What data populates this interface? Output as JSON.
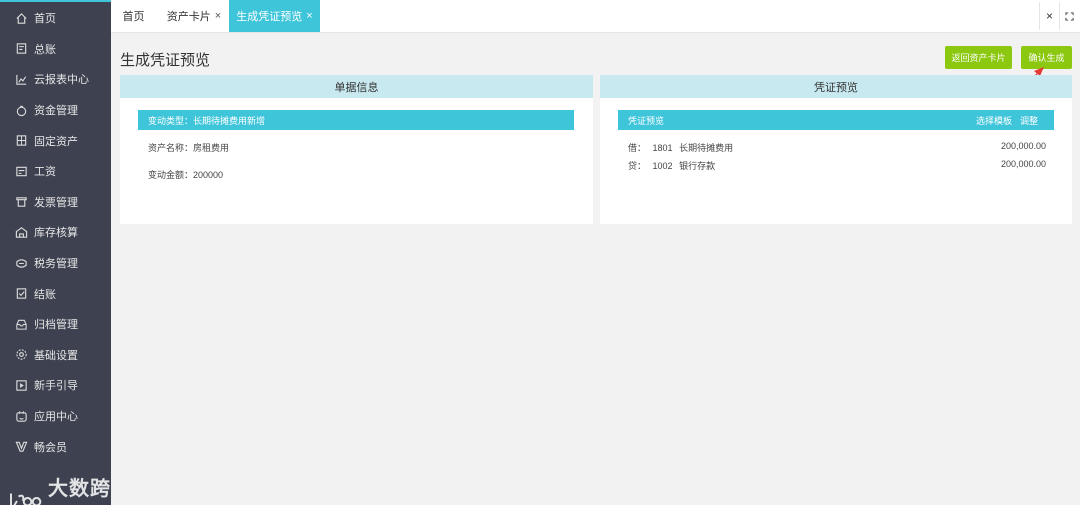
{
  "sidebar": {
    "items": [
      {
        "label": "首页",
        "icon": "home-icon"
      },
      {
        "label": "总账",
        "icon": "ledger-icon"
      },
      {
        "label": "云报表中心",
        "icon": "chart-icon"
      },
      {
        "label": "资金管理",
        "icon": "money-bag-icon"
      },
      {
        "label": "固定资产",
        "icon": "asset-icon"
      },
      {
        "label": "工资",
        "icon": "salary-icon"
      },
      {
        "label": "发票管理",
        "icon": "invoice-icon"
      },
      {
        "label": "库存核算",
        "icon": "warehouse-icon"
      },
      {
        "label": "税务管理",
        "icon": "tax-icon"
      },
      {
        "label": "结账",
        "icon": "closing-icon"
      },
      {
        "label": "归档管理",
        "icon": "archive-icon"
      },
      {
        "label": "基础设置",
        "icon": "gear-icon"
      },
      {
        "label": "新手引导",
        "icon": "play-guide-icon"
      },
      {
        "label": "应用中心",
        "icon": "app-center-icon"
      },
      {
        "label": "畅会员",
        "icon": "vip-icon"
      }
    ]
  },
  "watermark": {
    "text": "大数跨境"
  },
  "tabs": [
    {
      "label": "首页",
      "closable": false
    },
    {
      "label": "资产卡片",
      "closable": true
    },
    {
      "label": "生成凭证预览",
      "closable": true,
      "active": true
    }
  ],
  "tab_close_glyph": "×",
  "page_title": "生成凭证预览",
  "buttons": {
    "back": "返回资产卡片",
    "confirm": "确认生成"
  },
  "doc_panel": {
    "header": "单据信息",
    "bar_label": "变动类型：",
    "bar_value": "长期待摊费用新增",
    "asset_name_label": "资产名称：",
    "asset_name_value": "房租费用",
    "amount_label": "变动金额：",
    "amount_value": "200000"
  },
  "voucher_panel": {
    "header": "凭证预览",
    "bar_label": "凭证预览",
    "select_template": "选择模板",
    "adjust": "调整",
    "entries": [
      {
        "dc": "借：",
        "code": "1801",
        "account": "长期待摊费用",
        "amount": "200,000.00"
      },
      {
        "dc": "贷：",
        "code": "1002",
        "account": "银行存款",
        "amount": "200,000.00"
      }
    ]
  },
  "colors": {
    "sidebar_bg": "#3e4250",
    "accent": "#3fc5da",
    "green_button": "#8bc80f",
    "panel_header": "#c8e9ef",
    "arrow": "#e53935"
  }
}
